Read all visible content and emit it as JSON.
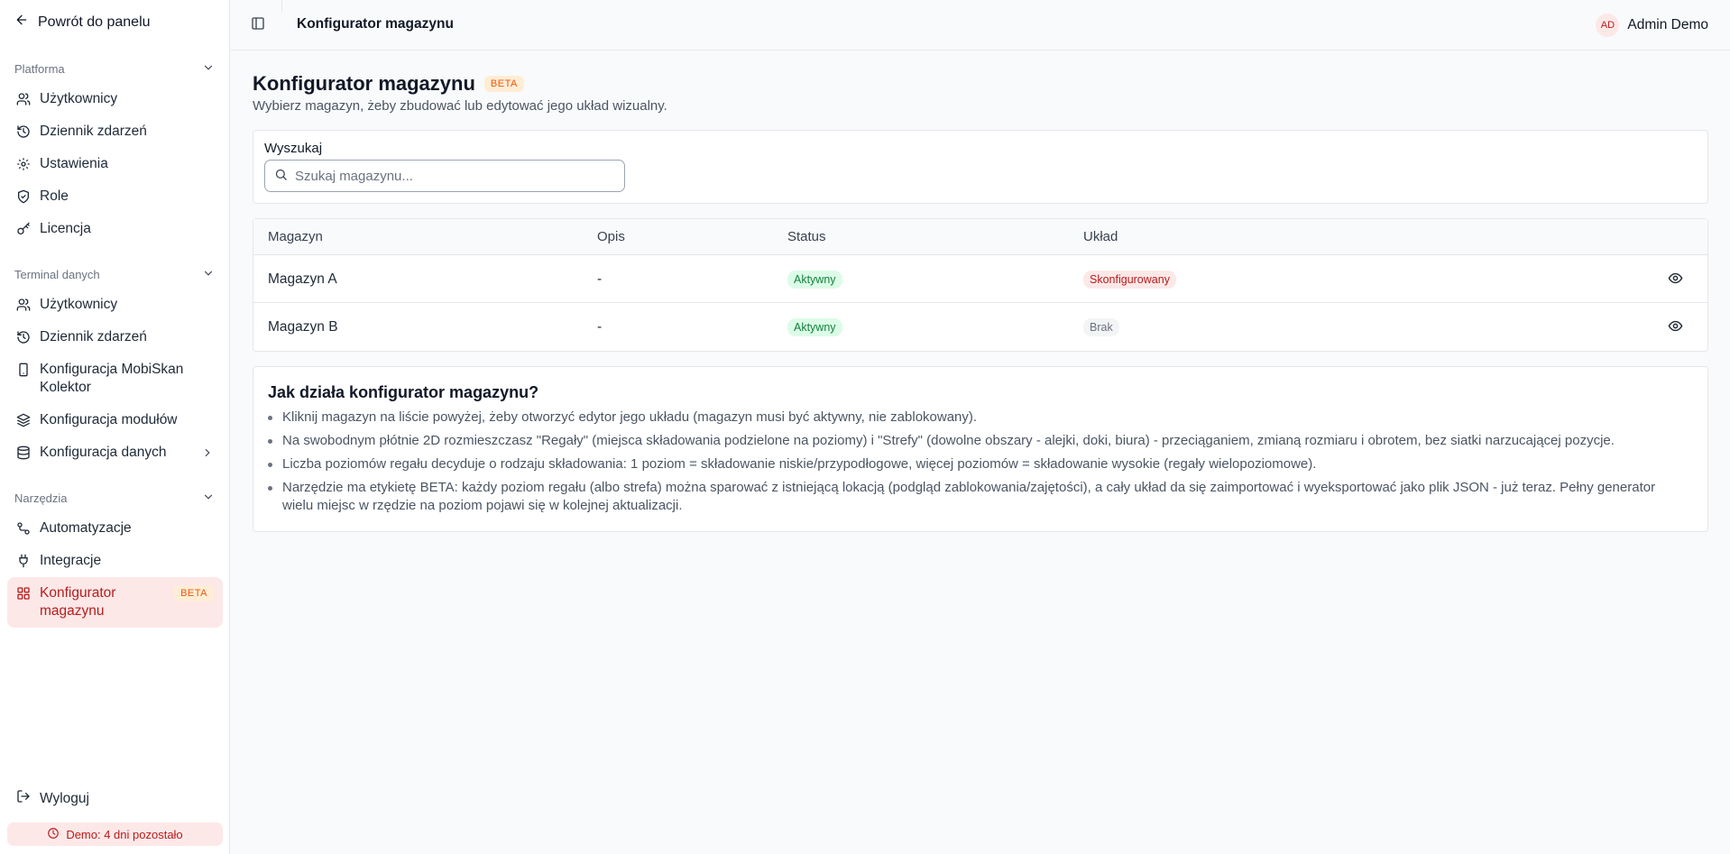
{
  "sidebar": {
    "back_label": "Powrót do panelu",
    "sections": [
      {
        "title": "Platforma",
        "items": [
          {
            "label": "Użytkownicy",
            "icon": "users-icon"
          },
          {
            "label": "Dziennik zdarzeń",
            "icon": "history-icon"
          },
          {
            "label": "Ustawienia",
            "icon": "gear-icon"
          },
          {
            "label": "Role",
            "icon": "shield-icon"
          },
          {
            "label": "Licencja",
            "icon": "key-icon"
          }
        ]
      },
      {
        "title": "Terminal danych",
        "items": [
          {
            "label": "Użytkownicy",
            "icon": "users-icon"
          },
          {
            "label": "Dziennik zdarzeń",
            "icon": "history-icon"
          },
          {
            "label": "Konfiguracja MobiSkan Kolektor",
            "icon": "smartphone-icon"
          },
          {
            "label": "Konfiguracja modułów",
            "icon": "layers-icon"
          },
          {
            "label": "Konfiguracja danych",
            "icon": "database-icon"
          }
        ]
      },
      {
        "title": "Narzędzia",
        "items": [
          {
            "label": "Automatyzacje",
            "icon": "workflow-icon"
          },
          {
            "label": "Integracje",
            "icon": "plug-icon"
          },
          {
            "label": "Konfigurator magazynu",
            "icon": "grid-icon",
            "badge": "BETA",
            "active": true
          }
        ]
      }
    ],
    "logout_label": "Wyloguj",
    "demo_label": "Demo: 4 dni pozostało"
  },
  "topbar": {
    "title": "Konfigurator magazynu",
    "user_initials": "AD",
    "user_name": "Admin Demo"
  },
  "page": {
    "title": "Konfigurator magazynu",
    "badge": "BETA",
    "subtitle": "Wybierz magazyn, żeby zbudować lub edytować jego układ wizualny."
  },
  "search": {
    "label": "Wyszukaj",
    "placeholder": "Szukaj magazynu...",
    "value": ""
  },
  "table": {
    "columns": [
      "Magazyn",
      "Opis",
      "Status",
      "Układ"
    ],
    "rows": [
      {
        "name": "Magazyn A",
        "description": "-",
        "status": "Aktywny",
        "layout": "Skonfigurowany"
      },
      {
        "name": "Magazyn B",
        "description": "-",
        "status": "Aktywny",
        "layout": "Brak"
      }
    ]
  },
  "help": {
    "title": "Jak działa konfigurator magazynu?",
    "items": [
      "Kliknij magazyn na liście powyżej, żeby otworzyć edytor jego układu (magazyn musi być aktywny, nie zablokowany).",
      "Na swobodnym płótnie 2D rozmieszczasz \"Regały\" (miejsca składowania podzielone na poziomy) i \"Strefy\" (dowolne obszary - alejki, doki, biura) - przeciąganiem, zmianą rozmiaru i obrotem, bez siatki narzucającej pozycje.",
      "Liczba poziomów regału decyduje o rodzaju składowania: 1 poziom = składowanie niskie/przypodłogowe, więcej poziomów = składowanie wysokie (regały wielopoziomowe).",
      "Narzędzie ma etykietę BETA: każdy poziom regału (albo strefa) można sparować z istniejącą lokacją (podgląd zablokowania/zajętości), a cały układ da się zaimportować i wyeksportować jako plik JSON - już teraz. Pełny generator wielu miejsc w rzędzie na poziom pojawi się w kolejnej aktualizacji."
    ]
  },
  "colors": {
    "accent": "#b91c1c",
    "accent_bg": "#fde8e8",
    "beta": "#ea580c",
    "active_status": "#15803d",
    "active_status_bg": "#dcfce7"
  }
}
